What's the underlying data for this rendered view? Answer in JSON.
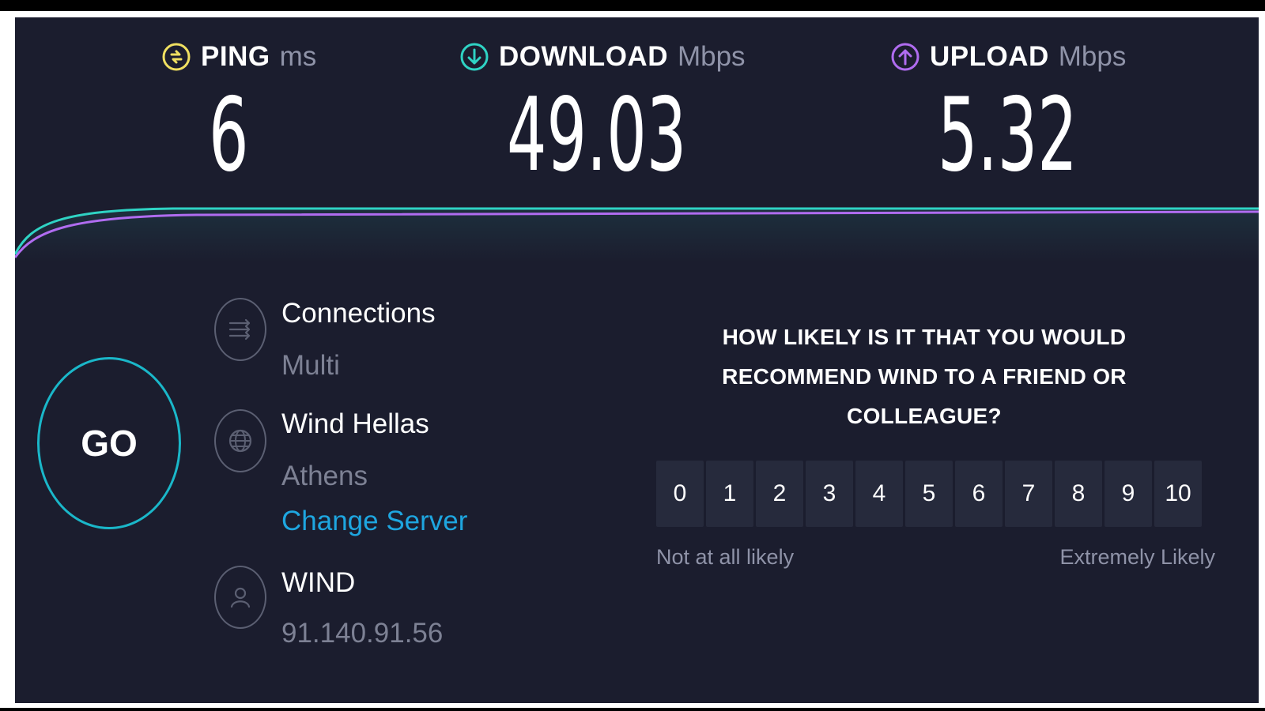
{
  "metrics": {
    "ping": {
      "label": "PING",
      "unit": "ms",
      "value": "6",
      "icon": "ping-icon",
      "color": "#f0e061"
    },
    "download": {
      "label": "DOWNLOAD",
      "unit": "Mbps",
      "value": "49.03",
      "icon": "download-arrow-icon",
      "color": "#2fd3c4"
    },
    "upload": {
      "label": "UPLOAD",
      "unit": "Mbps",
      "value": "5.32",
      "icon": "upload-arrow-icon",
      "color": "#b06cf0"
    }
  },
  "go_button": {
    "label": "GO",
    "color": "#1ab7c9"
  },
  "connections": {
    "title": "Connections",
    "value": "Multi",
    "icon": "connections-icon"
  },
  "server": {
    "name": "Wind Hellas",
    "location": "Athens",
    "change_label": "Change Server",
    "icon": "globe-icon"
  },
  "provider": {
    "name": "WIND",
    "ip": "91.140.91.56",
    "icon": "user-icon"
  },
  "survey": {
    "question_lines": [
      "HOW LIKELY IS IT THAT YOU WOULD",
      "RECOMMEND WIND TO A FRIEND OR",
      "COLLEAGUE?"
    ],
    "scale": [
      "0",
      "1",
      "2",
      "3",
      "4",
      "5",
      "6",
      "7",
      "8",
      "9",
      "10"
    ],
    "low_label": "Not at all likely",
    "high_label": "Extremely Likely"
  },
  "colors": {
    "background": "#1b1d2e",
    "accent_cyan": "#2fd3c4",
    "accent_purple": "#b06cf0",
    "link": "#1ea6e0"
  }
}
